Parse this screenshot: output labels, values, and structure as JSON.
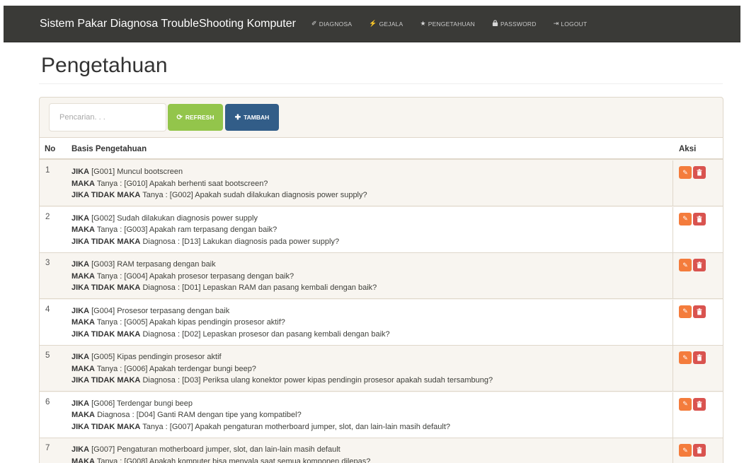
{
  "navbar": {
    "brand": "Sistem Pakar Diagnosa TroubleShooting Komputer",
    "items": [
      {
        "icon": "✓",
        "icon_name": "wrench-icon",
        "label": "DIAGNOSA"
      },
      {
        "icon": "⚡",
        "icon_name": "bolt-icon",
        "label": "GEJALA"
      },
      {
        "icon": "★",
        "icon_name": "star-icon",
        "label": "PENGETAHUAN"
      },
      {
        "icon": "🔒",
        "icon_name": "lock-icon",
        "label": "PASSWORD"
      },
      {
        "icon": "↪",
        "icon_name": "logout-icon",
        "label": "LOGOUT"
      }
    ]
  },
  "page": {
    "title": "Pengetahuan"
  },
  "toolbar": {
    "search_placeholder": "Pencarian. . .",
    "refresh_label": "REFRESH",
    "tambah_label": "TAMBAH"
  },
  "table": {
    "headers": {
      "no": "No",
      "basis": "Basis Pengetahuan",
      "aksi": "Aksi"
    },
    "rows": [
      {
        "no": "1",
        "jika": "[G001] Muncul bootscreen",
        "maka_type": "Tanya",
        "maka": "[G010] Apakah berhenti saat bootscreen?",
        "tidak_type": "Tanya",
        "tidak": "[G002] Apakah sudah dilakukan diagnosis power supply?"
      },
      {
        "no": "2",
        "jika": "[G002] Sudah dilakukan diagnosis power supply",
        "maka_type": "Tanya",
        "maka": "[G003] Apakah ram terpasang dengan baik?",
        "tidak_type": "Diagnosa",
        "tidak": "[D13] Lakukan diagnosis pada power supply?"
      },
      {
        "no": "3",
        "jika": "[G003] RAM terpasang dengan baik",
        "maka_type": "Tanya",
        "maka": "[G004] Apakah prosesor terpasang dengan baik?",
        "tidak_type": "Diagnosa",
        "tidak": "[D01] Lepaskan RAM dan pasang kembali dengan baik?"
      },
      {
        "no": "4",
        "jika": "[G004] Prosesor terpasang dengan baik",
        "maka_type": "Tanya",
        "maka": "[G005] Apakah kipas pendingin prosesor aktif?",
        "tidak_type": "Diagnosa",
        "tidak": "[D02] Lepaskan prosesor dan pasang kembali dengan baik?"
      },
      {
        "no": "5",
        "jika": "[G005] Kipas pendingin prosesor aktif",
        "maka_type": "Tanya",
        "maka": "[G006] Apakah terdengar bungi beep?",
        "tidak_type": "Diagnosa",
        "tidak": "[D03] Periksa ulang konektor power kipas pendingin prosesor apakah sudah tersambung?"
      },
      {
        "no": "6",
        "jika": "[G006] Terdengar bungi beep",
        "maka_type": "Diagnosa",
        "maka": "[D04] Ganti RAM dengan tipe yang kompatibel?",
        "tidak_type": "Tanya",
        "tidak": "[G007] Apakah pengaturan motherboard jumper, slot, dan lain-lain masih default?"
      },
      {
        "no": "7",
        "jika": "[G007] Pengaturan motherboard jumper, slot, dan lain-lain masih default",
        "maka_type": "Tanya",
        "maka": "[G008] Apakah komputer bisa menyala saat semua komponen dilepas?",
        "tidak_type": "",
        "tidak": ""
      }
    ],
    "keywords": {
      "jika": "JIKA",
      "maka": "MAKA",
      "jika_tidak_maka": "JIKA TIDAK MAKA"
    }
  },
  "colors": {
    "navbar": "#3a3a37",
    "refresh": "#93c54b",
    "tambah": "#325d88",
    "edit": "#f47c3c",
    "delete": "#d9534f"
  }
}
